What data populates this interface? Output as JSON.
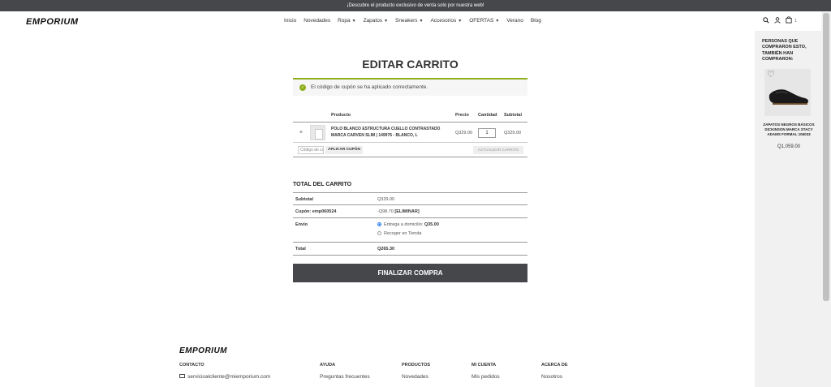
{
  "announcement": "¡Descubre el producto exclusivo de venta solo por nuestra web!",
  "header": {
    "logo": "EMPORIUM",
    "nav": [
      {
        "label": "Inicio",
        "has_menu": false
      },
      {
        "label": "Novedades",
        "has_menu": false
      },
      {
        "label": "Ropa",
        "has_menu": true
      },
      {
        "label": "Zapatos",
        "has_menu": true
      },
      {
        "label": "Sneakers",
        "has_menu": true
      },
      {
        "label": "Accesorios",
        "has_menu": true
      },
      {
        "label": "OFERTAS",
        "has_menu": true
      },
      {
        "label": "Verano",
        "has_menu": false
      },
      {
        "label": "Blog",
        "has_menu": false
      }
    ],
    "cart_count": "1",
    "icons": [
      "search-icon",
      "user-icon",
      "cart-icon"
    ]
  },
  "page": {
    "title": "EDITAR CARRITO",
    "notice": "El código de cupón se ha aplicado correctamente."
  },
  "cart": {
    "headers": {
      "product": "Producto",
      "price": "Precio",
      "quantity": "Cantidad",
      "subtotal": "Subtotal"
    },
    "items": [
      {
        "name": "POLO BLANCO ESTRUCTURA CUELLO CONTRASTADO MARCA CARVEN SLIM | 149976 - BLANCO, L",
        "price": "Q329.00",
        "quantity": "1",
        "subtotal": "Q329.00"
      }
    ],
    "coupon_placeholder": "Código de cupón",
    "apply_coupon": "APLICAR CUPÓN",
    "update_cart": "ACTUALIZAR CARRITO"
  },
  "totals": {
    "title": "TOTAL DEL CARRITO",
    "subtotal_label": "Subtotal",
    "subtotal": "Q329.00",
    "coupon_label": "Cupón: emp060524",
    "coupon_value": "-Q98.70",
    "coupon_remove": "[ELIMINAR]",
    "shipping_label": "Envío",
    "shipping_option_1_label": "Entrega a domicilio:",
    "shipping_option_1_price": "Q35.00",
    "shipping_option_2_label": "Recoger en Tienda",
    "total_label": "Total",
    "total": "Q265.30",
    "checkout": "FINALIZAR COMPRA"
  },
  "sidebar": {
    "title": "PERSONAS QUE COMPRARON ESTO, TAMBIÉN HAN COMPRARON:",
    "product_name": "ZAPATOS NEGROS BÁSICOS DICKINSON MARCA STACY ADAMS FORMAL 106033",
    "product_price": "Q1,059.00"
  },
  "footer": {
    "logo": "EMPORIUM",
    "contact_head": "CONTACTO",
    "contact_email": "servicioalcliente@miemporium.com",
    "help_head": "AYUDA",
    "help_link": "Preguntas frecuentes",
    "products_head": "PRODUCTOS",
    "products_link": "Novedades",
    "account_head": "MI CUENTA",
    "account_link": "Mis pedidos",
    "about_head": "ACERCA DE",
    "about_link": "Nosotros"
  },
  "colors": {
    "accent_dark": "#45474b",
    "success_green": "#8fae1b"
  }
}
